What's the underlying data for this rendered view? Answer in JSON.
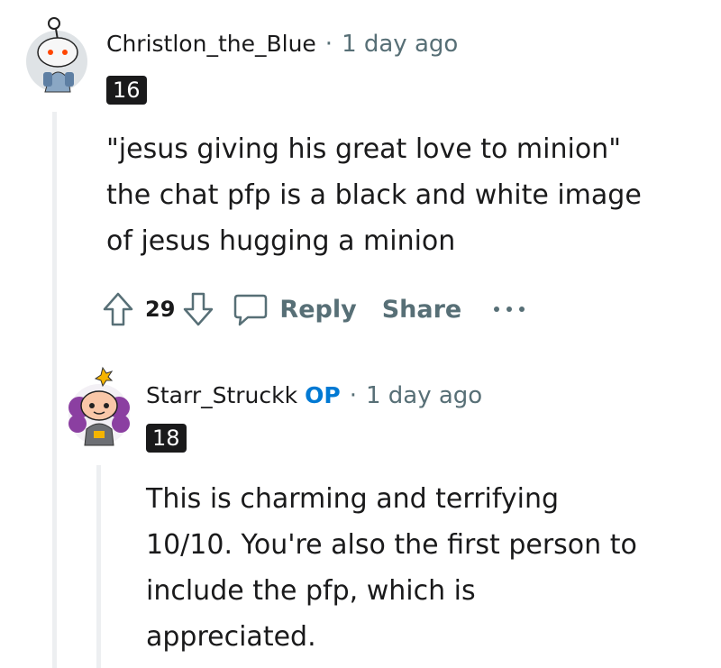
{
  "comments": [
    {
      "username": "Christlon_the_Blue",
      "separator": "·",
      "time": "1 day ago",
      "badge": "16",
      "body": [
        "\"jesus giving his great love to minion\"",
        "the chat pfp is a black and white image",
        "of jesus hugging a minion"
      ],
      "votes": "29",
      "reply_label": "Reply",
      "share_label": "Share",
      "more_label": "···"
    },
    {
      "username": "Starr_Struckk",
      "op_label": "OP",
      "separator": "·",
      "time": "1 day ago",
      "badge": "18",
      "body": [
        "This is charming and terrifying",
        "10/10. You're also the first person to",
        "include the pfp, which is",
        "appreciated."
      ]
    }
  ],
  "colors": {
    "op": "#0079d3",
    "muted": "#576f76",
    "thread_line": "#edeff1",
    "badge_bg": "#1a1a1b"
  },
  "icons": [
    "upvote-icon",
    "downvote-icon",
    "comment-icon",
    "more-icon"
  ]
}
